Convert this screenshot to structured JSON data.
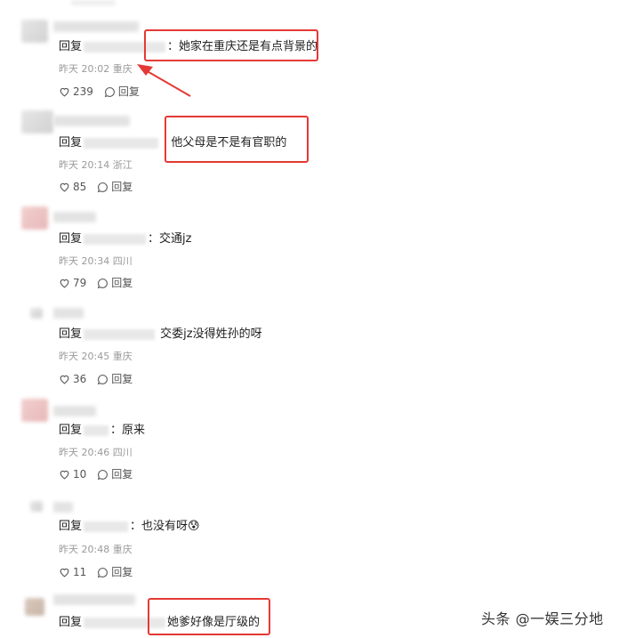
{
  "reply_prefix": "回复",
  "comments": [
    {
      "text": "：她家在重庆还是有点背景的",
      "time": "昨天 20:02",
      "location": "重庆",
      "likes": "239",
      "reply_label": "回复",
      "highlight": true
    },
    {
      "text": "他父母是不是有官职的",
      "time": "昨天 20:14",
      "location": "浙江",
      "likes": "85",
      "reply_label": "回复",
      "highlight": true
    },
    {
      "text": "：交通jz",
      "time": "昨天 20:34",
      "location": "四川",
      "likes": "79",
      "reply_label": "回复",
      "highlight": false
    },
    {
      "text": "交委jz没得姓孙的呀",
      "time": "昨天 20:45",
      "location": "重庆",
      "likes": "36",
      "reply_label": "回复",
      "highlight": false
    },
    {
      "text": "：原来",
      "time": "昨天 20:46",
      "location": "四川",
      "likes": "10",
      "reply_label": "回复",
      "highlight": false
    },
    {
      "text": "：也没有呀",
      "emoji": "😰",
      "time": "昨天 20:48",
      "location": "重庆",
      "likes": "11",
      "reply_label": "回复",
      "highlight": false
    },
    {
      "text": "她爹好像是厅级的",
      "highlight": true
    }
  ],
  "watermark": "头条 @一娱三分地",
  "colors": {
    "highlight_border": "#e53935",
    "meta_text": "#9a9a9a"
  },
  "icons": {
    "like": "heart-outline-icon",
    "reply": "speech-bubble-icon",
    "arrow": "red-arrow-icon"
  }
}
